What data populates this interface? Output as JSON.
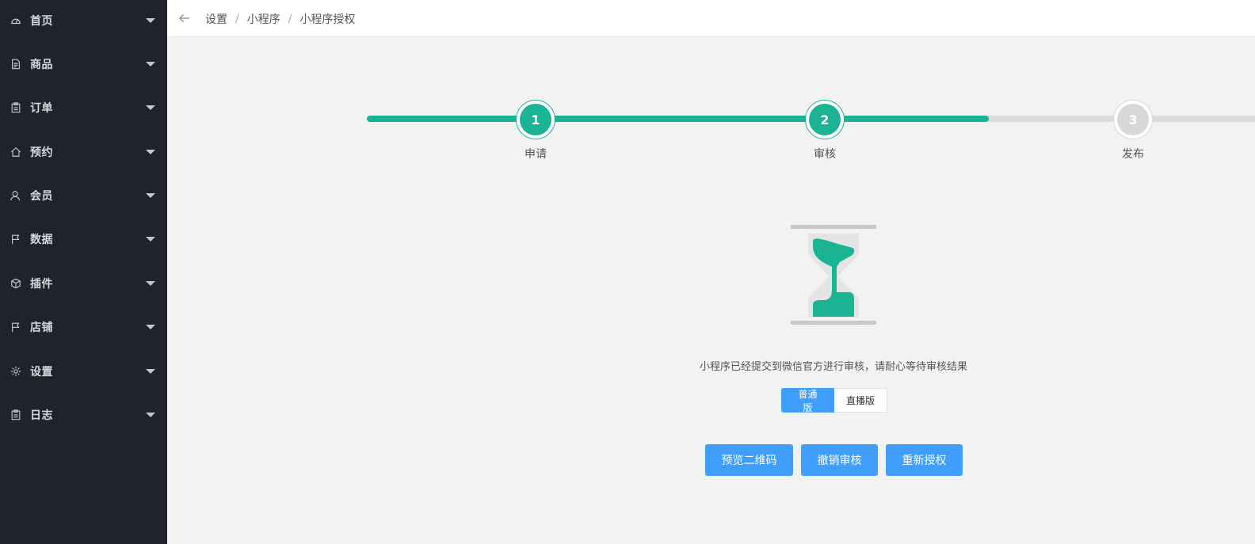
{
  "sidebar": {
    "items": [
      {
        "label": "首页",
        "icon": "dashboard-icon"
      },
      {
        "label": "商品",
        "icon": "document-icon"
      },
      {
        "label": "订单",
        "icon": "clipboard-icon"
      },
      {
        "label": "预约",
        "icon": "home-icon"
      },
      {
        "label": "会员",
        "icon": "user-icon"
      },
      {
        "label": "数据",
        "icon": "flag-icon"
      },
      {
        "label": "插件",
        "icon": "cube-icon"
      },
      {
        "label": "店铺",
        "icon": "flag-icon"
      },
      {
        "label": "设置",
        "icon": "gear-icon"
      },
      {
        "label": "日志",
        "icon": "clipboard-icon"
      }
    ]
  },
  "header": {
    "breadcrumb": [
      "设置",
      "小程序",
      "小程序授权"
    ],
    "separator": "/"
  },
  "steps": {
    "items": [
      {
        "number": "1",
        "label": "申请",
        "done": true
      },
      {
        "number": "2",
        "label": "审核",
        "done": true
      },
      {
        "number": "3",
        "label": "发布",
        "done": false
      }
    ],
    "progress_percent": 70
  },
  "main": {
    "message": "小程序已经提交到微信官方进行审核，请耐心等待审核结果",
    "versions": [
      {
        "label": "普通版",
        "active": true
      },
      {
        "label": "直播版",
        "active": false
      }
    ],
    "actions": {
      "preview_label": "预览二维码",
      "revoke_label": "撤销审核",
      "reauth_label": "重新授权"
    }
  },
  "colors": {
    "accent_green": "#1ab394",
    "primary_blue": "#409eff",
    "sidebar_bg": "#1f232b"
  }
}
